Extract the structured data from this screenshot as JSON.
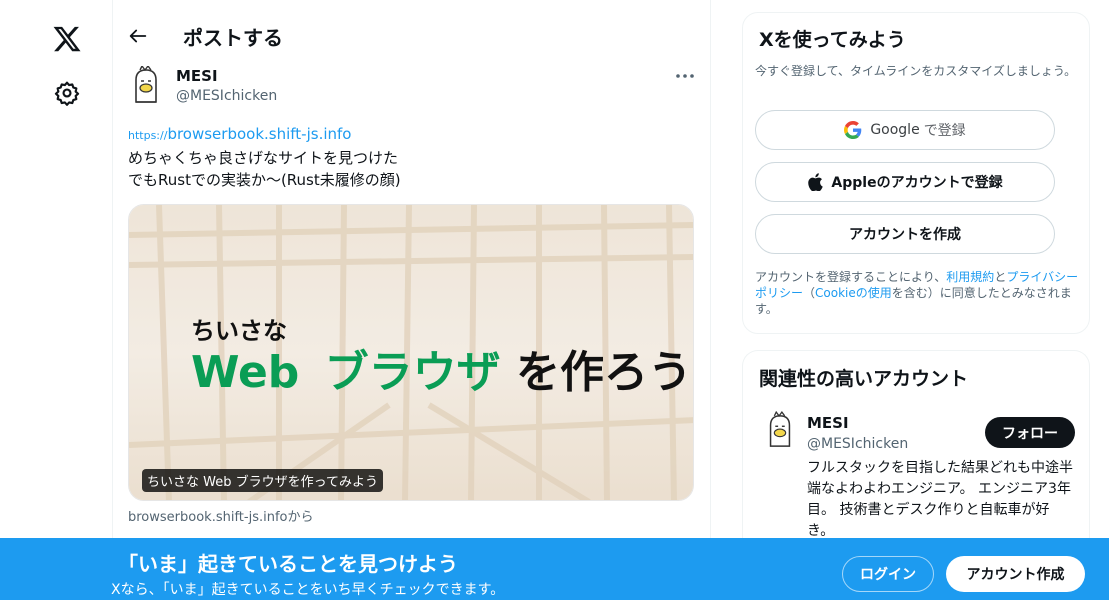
{
  "nav": {
    "logo_icon": "x-logo-icon",
    "settings_icon": "gear-icon"
  },
  "header": {
    "back_icon": "arrow-left-icon",
    "title": "ポストする"
  },
  "post": {
    "author_name": "MESI",
    "author_handle": "@MESIchicken",
    "link_protocol": "https://",
    "link_host": "browserbook.shift-js.info",
    "text_line1": "めちゃくちゃ良さげなサイトを見つけた",
    "text_line2": "でもRustでの実装か〜(Rust未履修の顔)",
    "card": {
      "headline_small": "ちいさな",
      "headline_web": "Web",
      "headline_browser": "ブラウザ",
      "headline_rest": "を作ろう",
      "caption": "ちいさな Web ブラウザを作ってみよう",
      "domain": "browserbook.shift-js.infoから"
    }
  },
  "signup_panel": {
    "title": "Xを使ってみよう",
    "subtitle": "今すぐ登録して、タイムラインをカスタマイズしましょう。",
    "google_label": "Google",
    "google_suffix": "で登録",
    "apple_label": "Appleのアカウントで登録",
    "create_label": "アカウントを作成",
    "legal_1": "アカウントを登録することにより、",
    "terms_link": "利用規約",
    "legal_2": "と",
    "privacy_link": "プライバシーポリシー",
    "legal_3": "（",
    "cookie_link": "Cookieの使用",
    "legal_4": "を含む）に同意したとみなされます。"
  },
  "related": {
    "title": "関連性の高いアカウント",
    "name": "MESI",
    "handle": "@MESIchicken",
    "follow_label": "フォロー",
    "bio": "フルスタックを目指した結果どれも中途半端なよわよわエンジニア。 エンジニア3年目。 技術書とデスク作りと自転車が好き。"
  },
  "bottom_bar": {
    "title": "「いま」起きていることを見つけよう",
    "subtitle": "Xなら、「いま」起きていることをいち早くチェックできます。",
    "login_label": "ログイン",
    "signup_label": "アカウント作成"
  },
  "colors": {
    "accent": "#1d9bf0",
    "text": "#0f1419",
    "muted": "#536471",
    "card_green": "#0a9d55"
  }
}
